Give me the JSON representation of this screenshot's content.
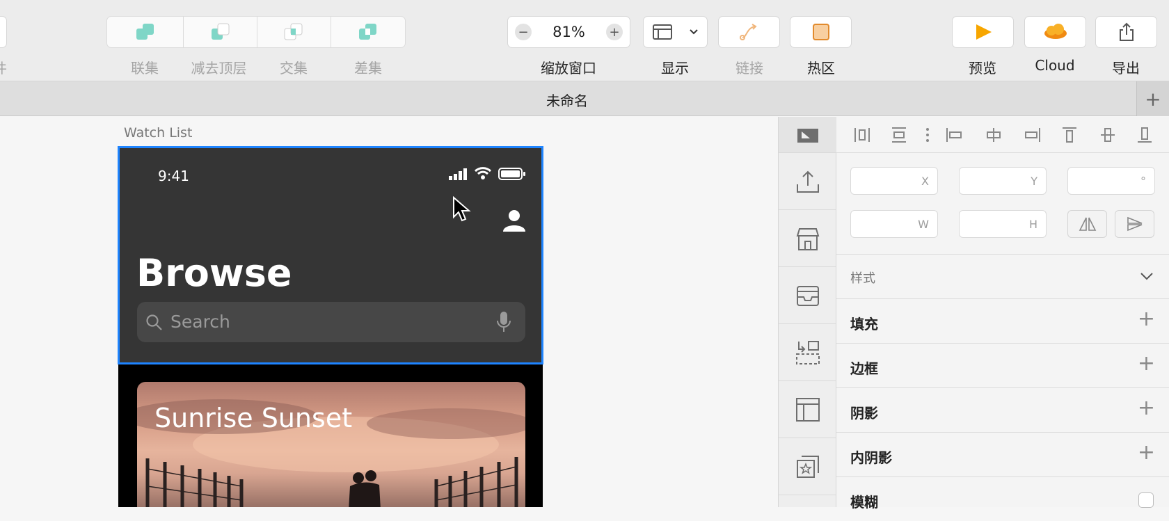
{
  "toolbar": {
    "left_partial_label": "件",
    "boolean_ops": [
      {
        "label": "联集",
        "icon": "union-icon"
      },
      {
        "label": "减去顶层",
        "icon": "subtract-icon"
      },
      {
        "label": "交集",
        "icon": "intersect-icon"
      },
      {
        "label": "差集",
        "icon": "difference-icon"
      }
    ],
    "zoom": {
      "value": "81%",
      "minus": "−",
      "plus": "+",
      "label": "缩放窗口"
    },
    "display_label": "显示",
    "link_label": "链接",
    "hotspot_label": "热区",
    "preview_label": "预览",
    "cloud_label": "Cloud",
    "export_label": "导出"
  },
  "tab": {
    "title": "未命名",
    "add": "+"
  },
  "canvas": {
    "artboard_name": "Watch List",
    "phone": {
      "time": "9:41",
      "title": "Browse",
      "search_placeholder": "Search",
      "card_title": "Sunrise Sunset"
    }
  },
  "inspector": {
    "fields": {
      "x": "X",
      "y": "Y",
      "rotation": "°",
      "w": "W",
      "h": "H"
    },
    "sections": [
      {
        "title": "样式",
        "control": "chevron"
      },
      {
        "title": "填充",
        "control": "+"
      },
      {
        "title": "边框",
        "control": "+"
      },
      {
        "title": "阴影",
        "control": "+"
      },
      {
        "title": "内阴影",
        "control": "+"
      },
      {
        "title": "模糊",
        "control": "checkbox"
      }
    ]
  },
  "colors": {
    "selection": "#1e84ff",
    "phone_header": "#353535",
    "accent_orange": "#f5a623"
  }
}
